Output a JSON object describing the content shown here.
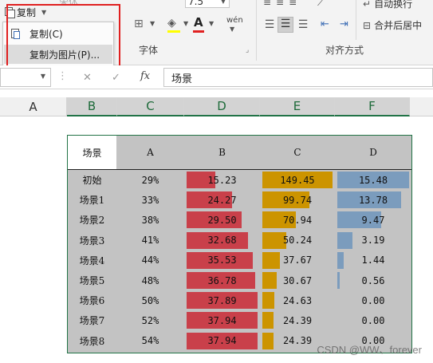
{
  "ribbon": {
    "copy_label": "复制",
    "font_size": "7.5",
    "font_group_label": "字体",
    "align_group_label": "对齐方式",
    "wrap_text_label": "自动换行",
    "merge_center_label": "合并后居中",
    "font_name_fragment": "宋体",
    "phonetic_glyph": "wén",
    "font_color_letter": "A"
  },
  "copy_menu": {
    "items": [
      {
        "label": "复制(C)",
        "highlighted": false
      },
      {
        "label": "复制为图片(P)...",
        "highlighted": true
      }
    ]
  },
  "formula_bar": {
    "name_box": "",
    "fx": "fx",
    "cancel_glyph": "✕",
    "enter_glyph": "✓",
    "content": "场景"
  },
  "column_headers": [
    {
      "label": "A",
      "selected": false
    },
    {
      "label": "B",
      "selected": true
    },
    {
      "label": "C",
      "selected": true
    },
    {
      "label": "D",
      "selected": true
    },
    {
      "label": "E",
      "selected": true
    },
    {
      "label": "F",
      "selected": true
    }
  ],
  "chart_data": {
    "type": "table",
    "headers": [
      "场景",
      "A",
      "B",
      "C",
      "D"
    ],
    "rows": [
      {
        "scene": "初始",
        "A": "29%",
        "B": 15.23,
        "C": 149.45,
        "D": 15.48
      },
      {
        "scene": "场景1",
        "A": "33%",
        "B": 24.27,
        "C": 99.74,
        "D": 13.78
      },
      {
        "scene": "场景2",
        "A": "38%",
        "B": 29.5,
        "C": 70.94,
        "D": 9.47
      },
      {
        "scene": "场景3",
        "A": "41%",
        "B": 32.68,
        "C": 50.24,
        "D": 3.19
      },
      {
        "scene": "场景4",
        "A": "44%",
        "B": 35.53,
        "C": 37.67,
        "D": 1.44
      },
      {
        "scene": "场景5",
        "A": "48%",
        "B": 36.78,
        "C": 30.67,
        "D": 0.56
      },
      {
        "scene": "场景6",
        "A": "50%",
        "B": 37.89,
        "C": 24.63,
        "D": 0.0
      },
      {
        "scene": "场景7",
        "A": "52%",
        "B": 37.94,
        "C": 24.39,
        "D": 0.0
      },
      {
        "scene": "场景8",
        "A": "54%",
        "B": 37.94,
        "C": 24.39,
        "D": 0.0
      }
    ],
    "bar_colors": {
      "B": "#c9404a",
      "C": "#cc9400",
      "D": "#7b9cbd"
    },
    "bar_max": {
      "B": 37.94,
      "C": 149.45,
      "D": 15.48
    }
  },
  "watermark": "CSDN @WW、forever"
}
